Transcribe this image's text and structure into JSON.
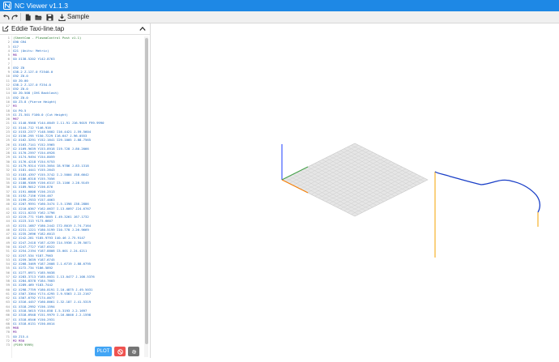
{
  "app": {
    "title": "NC Viewer  v1.1.3",
    "brand_color": "#1e88e5"
  },
  "toolbar": {
    "undo_icon": "undo-icon",
    "redo_icon": "redo-icon",
    "new_icon": "new-file-icon",
    "open_icon": "open-folder-icon",
    "save_icon": "save-icon",
    "sample_label": "Sample"
  },
  "editor": {
    "file_name": "Eddie Taxi-line.tap",
    "lines": [
      {
        "n": "1",
        "t": "(SheetCam - PlasmaControl Post v1.1)",
        "k": "cm"
      },
      {
        "n": "2",
        "t": "G90 G94",
        "k": "g"
      },
      {
        "n": "3",
        "t": "G17",
        "k": "g"
      },
      {
        "n": "4",
        "t": "G21 (Units: Metric)",
        "k": "g"
      },
      {
        "n": "5",
        "t": "M8",
        "k": "m"
      },
      {
        "n": "6",
        "t": "G0 X138.5202 Y142.8763",
        "k": "g"
      },
      {
        "n": "7",
        "t": "",
        "k": "g"
      },
      {
        "n": "8",
        "t": "G92 Z0",
        "k": "g"
      },
      {
        "n": "9",
        "t": "G38.2 Z-127.0 F2540.0",
        "k": "g"
      },
      {
        "n": "10",
        "t": "G92 Z0.0",
        "k": "g"
      },
      {
        "n": "11",
        "t": "G0 Z0.00",
        "k": "g"
      },
      {
        "n": "12",
        "t": "G38.2 Z-127.0 F254.0",
        "k": "g"
      },
      {
        "n": "13",
        "t": "G92 Z0.0",
        "k": "g"
      },
      {
        "n": "14",
        "t": "G0 Z0.508 (IHS Backlash)",
        "k": "g"
      },
      {
        "n": "15",
        "t": "G92 Z0.0",
        "k": "g"
      },
      {
        "n": "16",
        "t": "G0 Z3.8 (Pierce Height)",
        "k": "g"
      },
      {
        "n": "17",
        "t": "M3",
        "k": "m"
      },
      {
        "n": "18",
        "t": "G4 P0.5",
        "k": "g"
      },
      {
        "n": "19",
        "t": "G1 Z1.501 F100.0 (Cut Height)",
        "k": "g"
      },
      {
        "n": "20",
        "t": "M67",
        "k": "m"
      },
      {
        "n": "21",
        "t": "G1 X140.9568 Y144.0049 I-11.91 J16.9019 F99.9990",
        "k": "g"
      },
      {
        "n": "22",
        "t": "G1 X144.712 Y146.916",
        "k": "g"
      },
      {
        "n": "23",
        "t": "G2 X153.2377 Y148.5602 I16.4421 J-59.5604",
        "k": "g"
      },
      {
        "n": "24",
        "t": "G2 X156.295 Y150.7229 I16.647 J-96.0553",
        "k": "g"
      },
      {
        "n": "25",
        "t": "G2 X162.3291 Y152.1641 I29.1005 J-88.7565",
        "k": "g"
      },
      {
        "n": "26",
        "t": "G1 X163.7141 Y152.5965",
        "k": "g"
      },
      {
        "n": "27",
        "t": "G2 X169.9639 Y153.8918 I19.728 J-80.2066",
        "k": "g"
      },
      {
        "n": "28",
        "t": "G1 X170.2597 Y154.0928",
        "k": "g"
      },
      {
        "n": "29",
        "t": "G1 X174.9494 Y154.8059",
        "k": "g"
      },
      {
        "n": "30",
        "t": "G1 X176.4218 Y154.9753",
        "k": "g"
      },
      {
        "n": "31",
        "t": "G2 X179.9314 Y155.3654 I8.9786 J-83.1318",
        "k": "g"
      },
      {
        "n": "32",
        "t": "G1 X181.4441 Y155.2643",
        "k": "g"
      },
      {
        "n": "33",
        "t": "G2 X183.4397 Y155.3742 I-2.5004 J58.6642",
        "k": "g"
      },
      {
        "n": "34",
        "t": "G1 X186.6318 Y155.7056",
        "k": "g"
      },
      {
        "n": "35",
        "t": "G2 X188.9389 Y156.6317 I3.1166 J-28.9149",
        "k": "g"
      },
      {
        "n": "36",
        "t": "G1 X189.9012 Y156.876",
        "k": "g"
      },
      {
        "n": "37",
        "t": "G1 X191.6808 Y156.2513",
        "k": "g"
      },
      {
        "n": "38",
        "t": "G1 X192.7156 Y156.467",
        "k": "g"
      },
      {
        "n": "39",
        "t": "G1 X199.2933 Y157.4663",
        "k": "g"
      },
      {
        "n": "40",
        "t": "G2 X207.9591 Y160.3474 I-5.1398 J38.2886",
        "k": "g"
      },
      {
        "n": "41",
        "t": "G1 X210.0367 Y162.0637 I-13.6097 J24.6767",
        "k": "g"
      },
      {
        "n": "42",
        "t": "G1 X211.0233 Y162.1796",
        "k": "g"
      },
      {
        "n": "43",
        "t": "G2 X219.771 Y169.5865 I-49.3261 J67.1732",
        "k": "g"
      },
      {
        "n": "44",
        "t": "G1 X223.313 Y173.6607",
        "k": "g"
      },
      {
        "n": "45",
        "t": "G2 X231.1687 Y180.2442 I72.8019 J-74.7164",
        "k": "g"
      },
      {
        "n": "46",
        "t": "G2 X231.1221 Y180.5199 I10.778 J-26.9669",
        "k": "g"
      },
      {
        "n": "47",
        "t": "G1 X235.2696 Y182.6013",
        "k": "g"
      },
      {
        "n": "48",
        "t": "G2 X242.281 Y185.9793 I40.46 J-75.9147",
        "k": "g"
      },
      {
        "n": "49",
        "t": "G2 X247.2418 Y187.4239 I14.5936 J-39.5071",
        "k": "g"
      },
      {
        "n": "50",
        "t": "G1 X247.7727 Y187.6522",
        "k": "g"
      },
      {
        "n": "51",
        "t": "G2 X254.2194 Y187.8808 I3.001 J-24.4211",
        "k": "g"
      },
      {
        "n": "52",
        "t": "G1 X257.534 Y187.7963",
        "k": "g"
      },
      {
        "n": "53",
        "t": "G1 X259.3639 Y187.6745",
        "k": "g"
      },
      {
        "n": "54",
        "t": "G2 X268.3469 Y187.2608 I-1.6719 J-88.6795",
        "k": "g"
      },
      {
        "n": "55",
        "t": "G1 X272.734 Y186.5892",
        "k": "g"
      },
      {
        "n": "56",
        "t": "G1 X277.0971 Y185.9038",
        "k": "g"
      },
      {
        "n": "57",
        "t": "G2 X283.3713 Y185.0031 I-13.0477 J-108.5376",
        "k": "g"
      },
      {
        "n": "58",
        "t": "G1 X284.8378 Y184.7603",
        "k": "g"
      },
      {
        "n": "59",
        "t": "G1 X289.469 Y183.7442",
        "k": "g"
      },
      {
        "n": "60",
        "t": "G2 X298.7759 Y180.8191 I-10.4875 J-49.5031",
        "k": "g"
      },
      {
        "n": "61",
        "t": "G2 X307.3364 Y174.4295 I-9.9363 J-22.2167",
        "k": "g"
      },
      {
        "n": "62",
        "t": "G1 X307.6792 Y174.0077",
        "k": "g"
      },
      {
        "n": "63",
        "t": "G2 X316.4457 Y160.8661 I-32.187 J-41.5319",
        "k": "g"
      },
      {
        "n": "64",
        "t": "G1 X318.2992 Y156.1594",
        "k": "g"
      },
      {
        "n": "65",
        "t": "G1 X318.5615 Y154.858 I-5.3193 J-2.1697",
        "k": "g"
      },
      {
        "n": "66",
        "t": "G2 X318.6948 Y151.9979 I-16.0046 J-2.1598",
        "k": "g"
      },
      {
        "n": "67",
        "t": "G1 X318.6546 Y150.2931",
        "k": "g"
      },
      {
        "n": "68",
        "t": "G1 X318.6131 Y150.0014",
        "k": "g"
      },
      {
        "n": "69",
        "t": "M68",
        "k": "m"
      },
      {
        "n": "70",
        "t": "M5",
        "k": "m"
      },
      {
        "n": "71",
        "t": "G0 Z15.4",
        "k": "g"
      },
      {
        "n": "72",
        "t": "M2 M30",
        "k": "m"
      },
      {
        "n": "73",
        "t": "(P199 9999)",
        "k": "cm"
      }
    ]
  },
  "actions": {
    "plot_label": "PLOT",
    "plot_color": "#42a5f5",
    "stop_icon": "stop-icon",
    "stop_color": "#ef5350",
    "settings_icon": "gear-icon",
    "settings_color": "#757575"
  },
  "viewport": {
    "axis_colors": {
      "x": "#f57c00",
      "y": "#43a047",
      "z": "#1e3cff"
    },
    "toolpath_color": "#1a3fc7",
    "rapid_color": "#f4a300"
  }
}
